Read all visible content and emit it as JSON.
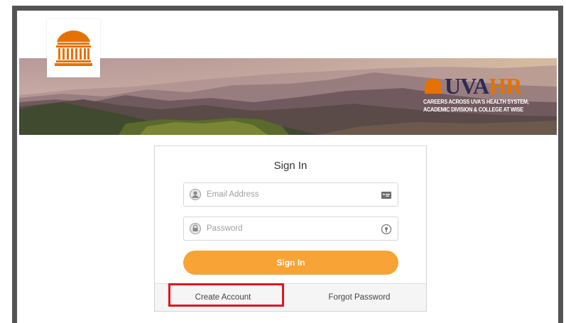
{
  "banner": {
    "brand_uva": "UVA",
    "brand_hr": "HR",
    "tagline_line1": "CAREERS ACROSS UVA'S HEALTH SYSTEM,",
    "tagline_line2": "ACADEMIC DIVISION & COLLEGE AT WISE",
    "colors": {
      "navy": "#2f2a55",
      "orange": "#e57200"
    }
  },
  "logo": {
    "icon": "rotunda-icon",
    "color": "#e57200"
  },
  "signin": {
    "title": "Sign In",
    "email_placeholder": "Email Address",
    "email_icon": "user-icon",
    "email_right_icon": "contact-card-icon",
    "password_placeholder": "Password",
    "password_icon": "lock-icon",
    "password_right_icon": "reveal-password-icon",
    "button_label": "Sign In",
    "button_color": "#f7a335"
  },
  "footer": {
    "create_account": "Create Account",
    "forgot_password": "Forgot Password"
  },
  "annotation": {
    "highlight_color": "#e1141e",
    "highlights": "create-account-link"
  }
}
